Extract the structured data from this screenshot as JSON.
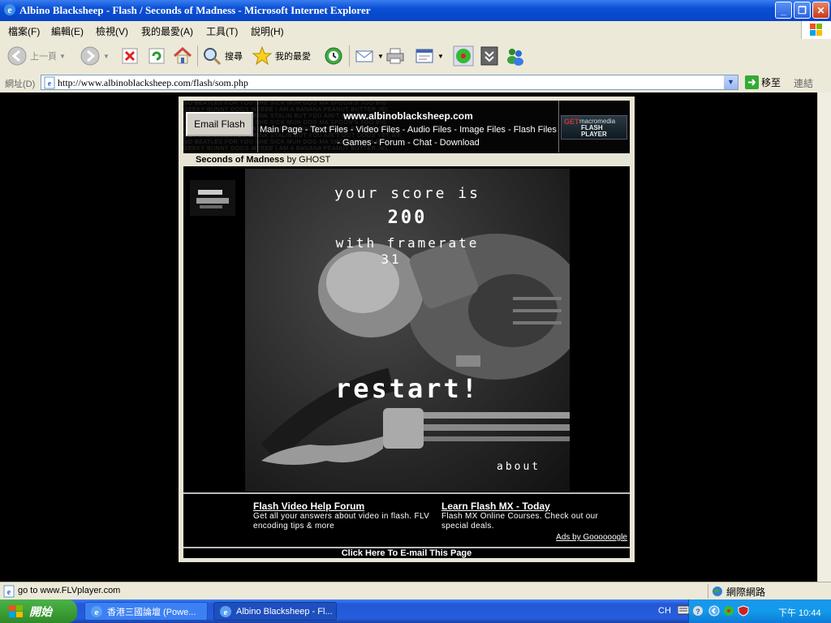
{
  "window": {
    "title": "Albino Blacksheep - Flash / Seconds of Madness - Microsoft Internet Explorer",
    "minimize": "_",
    "maximize": "❐",
    "close": "✕"
  },
  "menu": [
    "檔案(F)",
    "編輯(E)",
    "檢視(V)",
    "我的最愛(A)",
    "工具(T)",
    "說明(H)"
  ],
  "toolbar": {
    "back": "上一頁",
    "search": "搜尋",
    "favorites": "我的最愛"
  },
  "address": {
    "label": "網址(D)",
    "url": "http://www.albinoblacksheep.com/flash/som.php",
    "go": "移至",
    "links": "連結"
  },
  "page": {
    "email_flash": "Email Flash",
    "site_name": "www.albinoblacksheep.com",
    "nav": "Main Page - Text Files - Video Files - Audio Files - Image Files - Flash Files - Games - Forum - Chat - Download",
    "get_flash": {
      "get": "GET",
      "brand": "macromedia",
      "product": "FLASH PLAYER"
    },
    "bg_text": [
      "NO BEATLES FOR YOU SHE SICK MUH DOG MA SPOON'S TOO BIG",
      "GEEKY BUNNY DOGS WEEEE I AM A BANANA PEANUT BUTTER JEL",
      "NOT THE MAMA YOU DRINK STALIN BUT YOU AIN'T GOT DOGS YET WE",
      "NO BEATLES FOR YOU SHE SICK MUH DOG MA SPOON'S TOO BIG",
      "GEEKY BUNNY DOGS WEEEE I AM A BANANA PEANUT BUTTER JEL",
      "NOT THE MAMA YOU DRINK STALIN BUT YOU AIN'T GOT DOGS YET WE",
      "NO BEATLES FOR YOU SHE SICK MUH DOG MA SPOON'S TOO BIG",
      "GEEKY BUNNY DOGS WEEEE I AM A BANANA PEANUT BUTTER JEL"
    ],
    "title": "Seconds of Madness",
    "by": "by GHOST",
    "game": {
      "score_label": "your score is",
      "score": "200",
      "framerate_label": "with framerate",
      "framerate": "31",
      "restart": "restart!",
      "about": "about"
    },
    "ads": [
      {
        "title": "Flash Video Help Forum",
        "desc": "Get all your answers about video in flash. FLV encoding tips & more"
      },
      {
        "title": "Learn Flash MX - Today",
        "desc": "Flash MX Online Courses. Check out our special deals."
      }
    ],
    "ads_by": "Ads by Goooooogle",
    "email_page": "Click Here To E-mail This Page"
  },
  "status": {
    "text": "go to www.FLVplayer.com",
    "zone": "網際網路"
  },
  "taskbar": {
    "start": "開始",
    "tasks": [
      "香港三國論壇 (Powe...",
      "Albino Blacksheep - Fl..."
    ],
    "lang": "CH",
    "clock": "下午 10:44"
  },
  "colors": {
    "title_blue": "#0a4fd6",
    "chrome": "#ece9d8",
    "start_green": "#3a9b33"
  }
}
